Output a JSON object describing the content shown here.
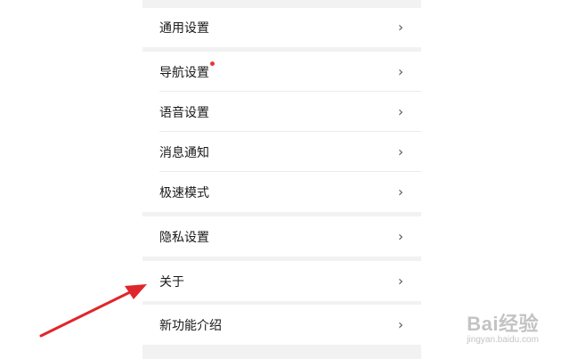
{
  "settings": {
    "items": [
      {
        "label": "通用设置"
      },
      {
        "label": "导航设置"
      },
      {
        "label": "语音设置"
      },
      {
        "label": "消息通知"
      },
      {
        "label": "极速模式"
      },
      {
        "label": "隐私设置"
      },
      {
        "label": "关于"
      },
      {
        "label": "新功能介绍"
      }
    ],
    "chevron": "›"
  },
  "icons": {
    "chevron": "chevron-right-icon",
    "dot": "red-notification-dot",
    "arrow": "red-pointer-arrow"
  },
  "colors": {
    "accent_red": "#e53935",
    "background": "#f2f2f2",
    "row_bg": "#ffffff"
  },
  "watermark": {
    "logo_text": "Bai经验",
    "url": "jingyan.baidu.com"
  }
}
